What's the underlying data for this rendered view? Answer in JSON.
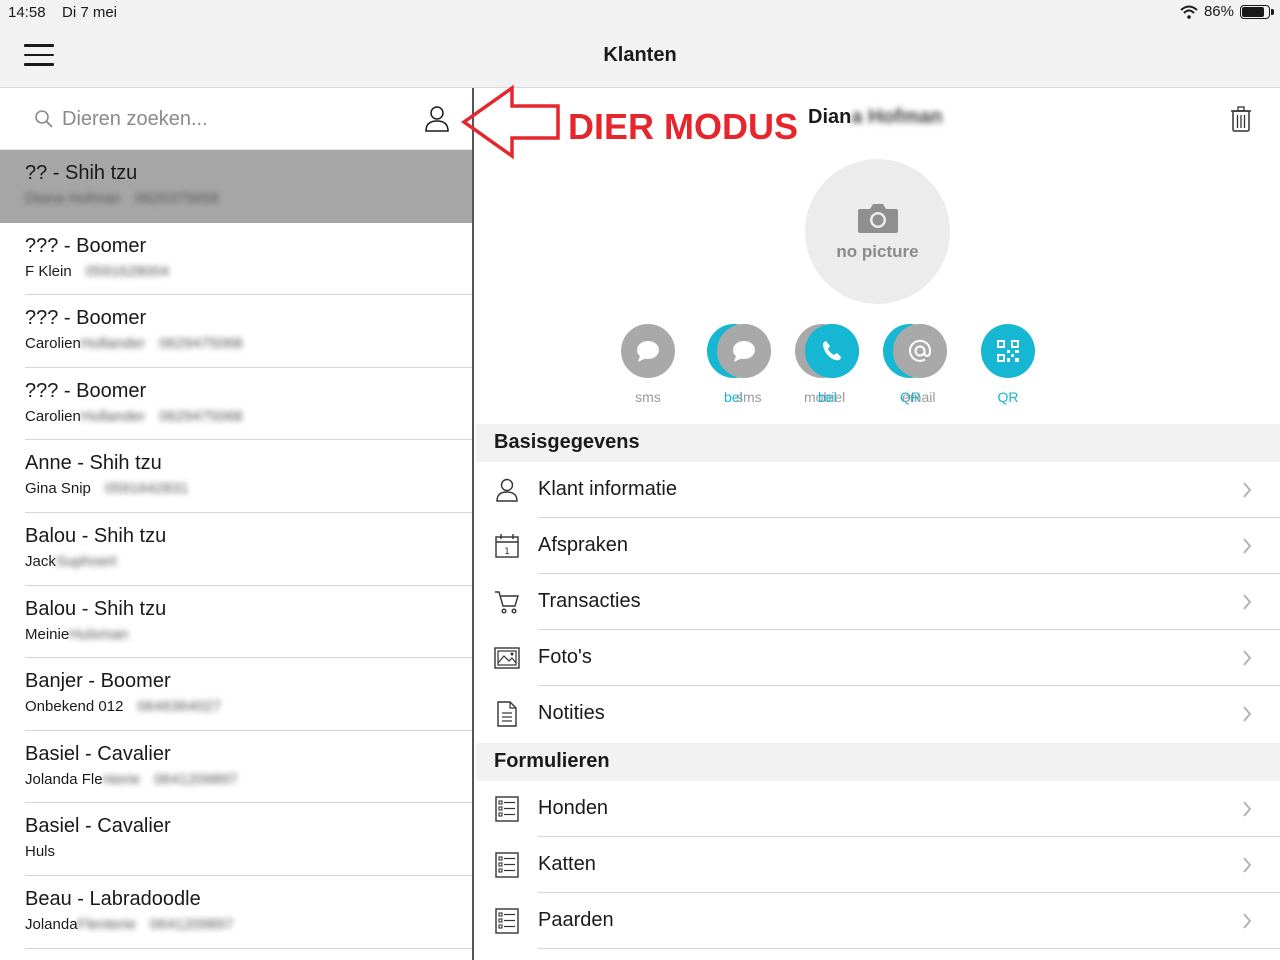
{
  "status_bar": {
    "time": "14:58",
    "date": "Di 7 mei",
    "battery": "86%",
    "battery_level": 0.86
  },
  "nav": {
    "title": "Klanten"
  },
  "search": {
    "placeholder": "Dieren zoeken..."
  },
  "animals": [
    {
      "name": "?? - Shih tzu",
      "owner": "Diana Hofman",
      "phone": "0625375658",
      "selected": true
    },
    {
      "name": "??? - Boomer",
      "owner": "F Klein",
      "phone": "0591628004"
    },
    {
      "name": "??? - Boomer",
      "owner": "Carolien",
      "owner_hidden": "Hollander",
      "phone": "0629475068"
    },
    {
      "name": "??? - Boomer",
      "owner": "Carolien",
      "owner_hidden": "Hollander",
      "phone": "0629475068"
    },
    {
      "name": "Anne - Shih tzu",
      "owner": "Gina Snip",
      "phone": "0591642831"
    },
    {
      "name": "Balou - Shih tzu",
      "owner": "Jack",
      "owner_hidden": "Suphoert"
    },
    {
      "name": "Balou - Shih tzu",
      "owner": "Meinie",
      "owner_hidden": "Hulsman"
    },
    {
      "name": "Banjer - Boomer",
      "owner": "Onbekend 012",
      "phone": "0646364027"
    },
    {
      "name": "Basiel - Cavalier",
      "owner": "Jolanda Fle",
      "owner_hidden": "nterie",
      "phone": "0641209897"
    },
    {
      "name": "Basiel - Cavalier",
      "owner": " Huls"
    },
    {
      "name": "Beau - Labradoodle",
      "owner": "Jolanda",
      "owner_hidden": "Flenterie",
      "phone": "0641209897"
    }
  ],
  "detail": {
    "name_visible": "Dian",
    "name_hidden": "a Hofman",
    "avatar_label": "no picture",
    "actions": [
      {
        "label": "sms",
        "style": "gray",
        "icon": "chat-icon"
      },
      {
        "label": "bel",
        "overlap_label": "sms",
        "style": "teal-gray",
        "icon": "chat-icon"
      },
      {
        "label": "bel",
        "overlap_label": "mobiel",
        "style": "gray-teal",
        "icon": "phone-icon"
      },
      {
        "label": "QR",
        "overlap_label": "email",
        "style": "teal-gray",
        "icon": "at-icon"
      },
      {
        "label": "QR",
        "style": "teal",
        "icon": "qr-icon"
      }
    ],
    "sections": [
      {
        "title": "Basisgegevens",
        "rows": [
          {
            "label": "Klant informatie",
            "icon": "person-icon"
          },
          {
            "label": "Afspraken",
            "icon": "calendar-icon",
            "icon_text": "1"
          },
          {
            "label": "Transacties",
            "icon": "cart-icon"
          },
          {
            "label": "Foto's",
            "icon": "photo-icon"
          },
          {
            "label": "Notities",
            "icon": "note-icon"
          }
        ]
      },
      {
        "title": "Formulieren",
        "rows": [
          {
            "label": "Honden",
            "icon": "form-icon"
          },
          {
            "label": "Katten",
            "icon": "form-icon"
          },
          {
            "label": "Paarden",
            "icon": "form-icon"
          }
        ]
      }
    ]
  },
  "annotation": {
    "text": "DIER MODUS",
    "color": "#e6262d"
  },
  "colors": {
    "accent": "#16b7d3",
    "action_gray": "#a9a9a9",
    "selected_row": "#a6a6a6"
  }
}
